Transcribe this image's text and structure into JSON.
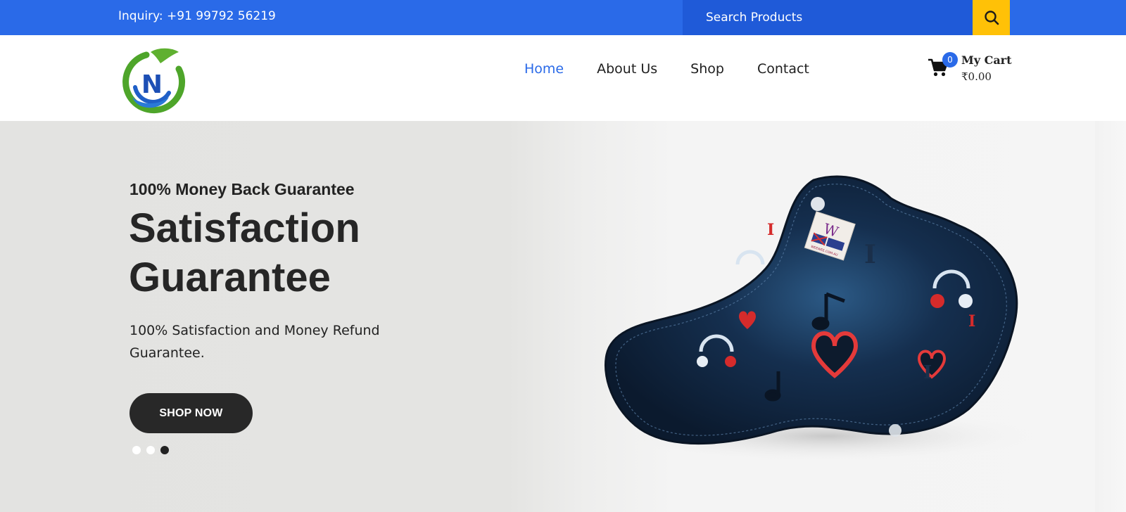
{
  "topbar": {
    "inquiry": "Inquiry: +91 99792 56219",
    "search_placeholder": "Search Products",
    "search_icon": "search-icon"
  },
  "header": {
    "logo_letter": "N",
    "nav": [
      "Home",
      "About Us",
      "Shop",
      "Contact"
    ],
    "active_nav": "Home",
    "cart": {
      "count": "0",
      "title": "My Cart",
      "total": "₹0.00",
      "icon": "cart-icon"
    }
  },
  "hero": {
    "eyebrow": "100% Money Back Guarantee",
    "title": "Satisfaction Guarantee",
    "description": "100% Satisfaction and Money Refund Guarantee.",
    "button": "SHOP NOW",
    "slides": 3,
    "active_slide": 3,
    "product_label_text": "WEEWEE.COM.AU"
  },
  "colors": {
    "primary": "#2a6ae8",
    "search_bg": "#1f5ad8",
    "search_button": "#ffc107",
    "button_dark": "#282828",
    "hero_bg": "#e4e4e2"
  }
}
